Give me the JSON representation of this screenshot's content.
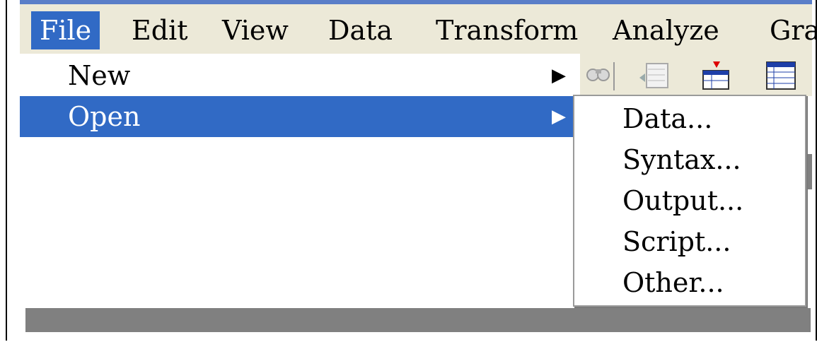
{
  "menubar": {
    "items": [
      {
        "label": "File",
        "active": true
      },
      {
        "label": "Edit"
      },
      {
        "label": "View"
      },
      {
        "label": "Data"
      },
      {
        "label": "Transform"
      },
      {
        "label": "Analyze"
      },
      {
        "label": "Gra"
      }
    ]
  },
  "file_menu": {
    "items": [
      {
        "label": "New",
        "arrow": "▶"
      },
      {
        "label": "Open",
        "arrow": "▶",
        "active": true
      }
    ]
  },
  "open_submenu": {
    "items": [
      {
        "label": "Data..."
      },
      {
        "label": "Syntax..."
      },
      {
        "label": "Output..."
      },
      {
        "label": "Script..."
      },
      {
        "label": "Other..."
      }
    ]
  },
  "toolbar": {
    "icons": [
      "find-icon",
      "goto-case-icon",
      "insert-variable-icon",
      "data-grid-icon"
    ]
  },
  "colors": {
    "highlight": "#316ac5",
    "menubar_bg": "#ece9d8"
  }
}
